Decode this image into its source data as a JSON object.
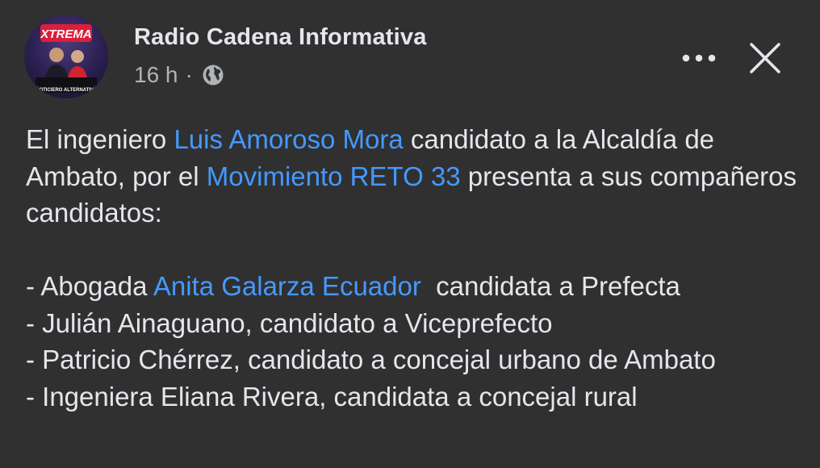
{
  "post": {
    "page_name": "Radio Cadena Informativa",
    "timestamp": "16 h",
    "separator": "·",
    "audience_icon": "globe-icon",
    "more_icon": "more-dots-icon",
    "close_icon": "close-icon",
    "avatar": {
      "logo_text": "XTREMA",
      "badge_text": "NOTICIERO ALTERNATIVA"
    },
    "colors": {
      "background": "#303031",
      "text": "#e4e6eb",
      "secondary_text": "#b0b3b8",
      "link": "#4599ff"
    },
    "body": {
      "p1_prefix": "El ingeniero ",
      "p1_link1": "Luis Amoroso Mora",
      "p1_mid": " candidato a la Alcaldía de Ambato, por el ",
      "p1_link2": "Movimiento RETO 33",
      "p1_suffix": " presenta a sus compañeros candidatos:",
      "line1_prefix": "- Abogada ",
      "line1_link": "Anita Galarza Ecuador",
      "line1_suffix": "  candidata a Prefecta",
      "line2": "- Julián Ainaguano, candidato a Viceprefecto",
      "line3": "- Patricio Chérrez, candidato a concejal urbano de Ambato",
      "line4": "- Ingeniera Eliana Rivera, candidata a concejal rural"
    }
  }
}
